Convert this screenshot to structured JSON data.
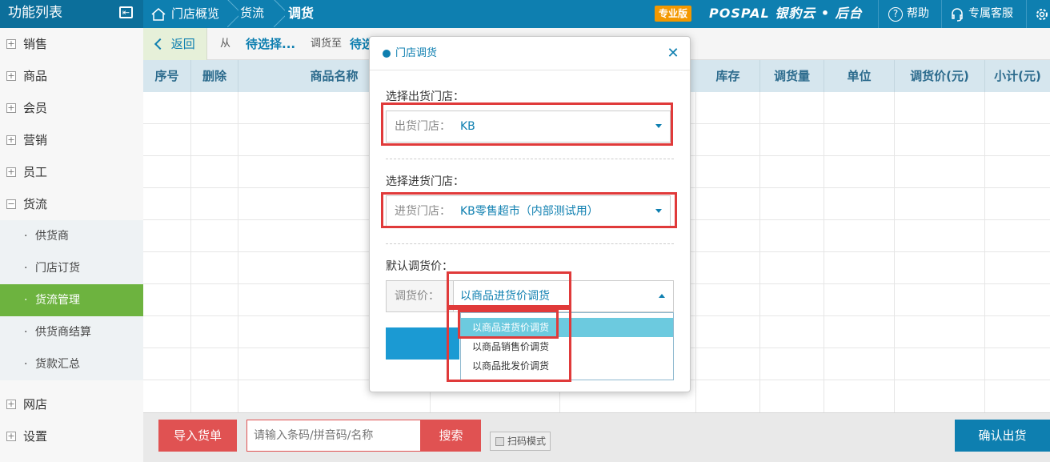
{
  "topbar": {
    "function_list": "功能列表",
    "crumbs": [
      "门店概览",
      "货流",
      "调货"
    ],
    "pro_badge": "专业版",
    "brand": "POSPAL 银豹云 • 后台",
    "help": "帮助",
    "service": "专属客服"
  },
  "sidebar": {
    "items": [
      "销售",
      "商品",
      "会员",
      "营销",
      "员工",
      "货流"
    ],
    "sub_items": [
      "供货商",
      "门店订货",
      "货流管理",
      "供货商结算",
      "货款汇总"
    ],
    "bottom_items": [
      "网店",
      "设置"
    ]
  },
  "subbar": {
    "back": "返回",
    "from": "从",
    "from_value": "待选择...",
    "to_label": "调货至",
    "to_value": "待选"
  },
  "table": {
    "headers": [
      "序号",
      "删除",
      "商品名称",
      "库存",
      "调货量",
      "单位",
      "调货价(元)",
      "小计(元)"
    ]
  },
  "footer": {
    "import_btn": "导入货单",
    "search_placeholder": "请输入条码/拼音码/名称",
    "search_btn": "搜索",
    "scan_mode": "扫码模式",
    "confirm_btn": "确认出货"
  },
  "modal": {
    "title": "门店调货",
    "out_section": "选择出货门店：",
    "out_label": "出货门店：",
    "out_value": "KB",
    "in_section": "选择进货门店：",
    "in_label": "进货门店：",
    "in_value": "KB零售超市（内部测试用）",
    "price_section": "默认调货价：",
    "price_label": "调货价：",
    "price_value": "以商品进货价调货",
    "options": [
      "以商品进货价调货",
      "以商品销售价调货",
      "以商品批发价调货"
    ]
  },
  "colors": {
    "primary": "#0e7fb0",
    "accent_green": "#6db33f",
    "danger": "#e05252",
    "highlight": "#e03a3a"
  }
}
